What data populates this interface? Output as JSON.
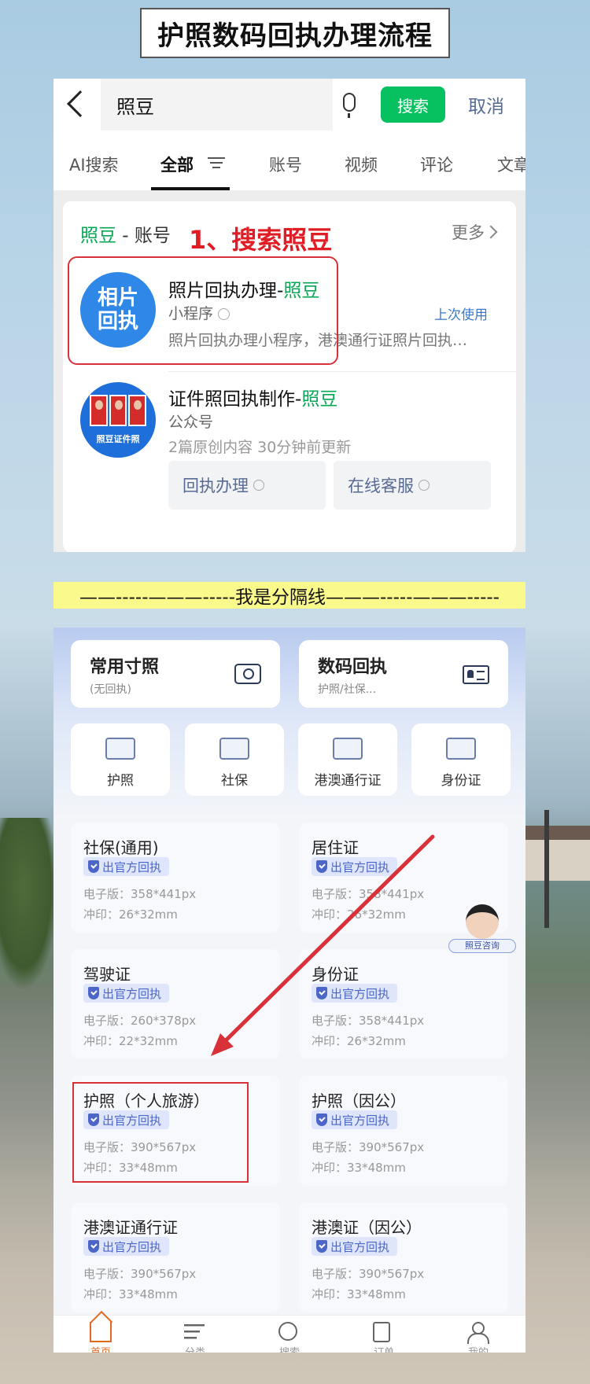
{
  "title": "护照数码回执办理流程",
  "search": {
    "query": "照豆",
    "button_label": "搜索",
    "cancel_label": "取消"
  },
  "tabs": [
    "AI搜索",
    "全部",
    "账号",
    "视频",
    "评论",
    "文章"
  ],
  "results": {
    "section_keyword": "照豆",
    "section_suffix": " - 账号",
    "more_label": "更多",
    "annotation": "1、搜索照豆",
    "mini_program": {
      "avatar_text": "相片回执",
      "title_prefix": "照片回执办理-",
      "title_keyword": "照豆",
      "type": "小程序",
      "last_used": "上次使用",
      "description": "照片回执办理小程序，港澳通行证照片回执…"
    },
    "official_account": {
      "avatar_caption": "照豆证件照",
      "title_prefix": "证件照回执制作-",
      "title_keyword": "照豆",
      "type": "公众号",
      "meta": "2篇原创内容  30分钟前更新",
      "buttons": [
        "回执办理",
        "在线客服"
      ]
    }
  },
  "divider_text": "——-----———-----我是分隔线———-----———-----",
  "app": {
    "big_cards": [
      {
        "title": "常用寸照",
        "subtitle": "(无回执)",
        "icon": "camera-icon"
      },
      {
        "title": "数码回执",
        "subtitle": "护照/社保...",
        "icon": "id-card-icon"
      }
    ],
    "categories": [
      "护照",
      "社保",
      "港澳通行证",
      "身份证"
    ],
    "badge_label": "出官方回执",
    "specs": [
      {
        "name": "社保(通用)",
        "digital": "电子版：358*441px",
        "print": "冲印：26*32mm"
      },
      {
        "name": "居住证",
        "digital": "电子版：358*441px",
        "print": "冲印：26*32mm"
      },
      {
        "name": "驾驶证",
        "digital": "电子版：260*378px",
        "print": "冲印：22*32mm"
      },
      {
        "name": "身份证",
        "digital": "电子版：358*441px",
        "print": "冲印：26*32mm"
      },
      {
        "name": "护照（个人旅游）",
        "digital": "电子版：390*567px",
        "print": "冲印：33*48mm"
      },
      {
        "name": "护照（因公）",
        "digital": "电子版：390*567px",
        "print": "冲印：33*48mm"
      },
      {
        "name": "港澳证通行证",
        "digital": "电子版：390*567px",
        "print": "冲印：33*48mm"
      },
      {
        "name": "港澳证（因公）",
        "digital": "电子版：390*567px",
        "print": "冲印：33*48mm"
      }
    ],
    "consult_label": "照豆咨询",
    "tabbar": [
      {
        "label": "首页",
        "icon": "home-icon",
        "active": true
      },
      {
        "label": "分类",
        "icon": "list-icon",
        "active": false
      },
      {
        "label": "搜索",
        "icon": "search-icon",
        "active": false
      },
      {
        "label": "订单",
        "icon": "order-icon",
        "active": false
      },
      {
        "label": "我的",
        "icon": "user-icon",
        "active": false
      }
    ]
  },
  "colors": {
    "wechat_green": "#07c160",
    "highlight_red": "#d8313a",
    "link_blue": "#576b95",
    "badge_blue": "#4b66c7"
  }
}
